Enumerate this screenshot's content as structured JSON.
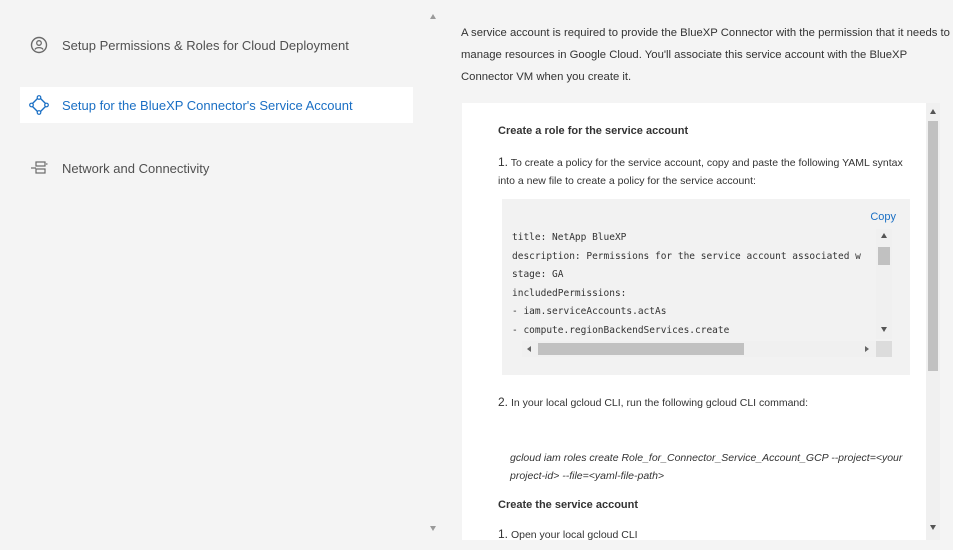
{
  "sidebar": {
    "items": [
      {
        "label": "Setup Permissions & Roles for Cloud Deployment",
        "icon": "user-circle-icon",
        "active": false
      },
      {
        "label": "Setup for the BlueXP Connector's Service Account",
        "icon": "connector-diamond-icon",
        "active": true
      },
      {
        "label": "Network and Connectivity",
        "icon": "network-icon",
        "active": false
      }
    ]
  },
  "main": {
    "intro": "A service account is required to provide the BlueXP Connector with the permission that it needs to manage resources in Google Cloud. You'll associate this service account with the BlueXP Connector VM when you create it.",
    "section1_title": "Create a role for the service account",
    "step1_num": "1.",
    "step1_text": "To create a policy for the service account, copy and paste the following YAML syntax into a new file to create a policy for the service account:",
    "copy_label": "Copy",
    "code_lines": [
      "title: NetApp BlueXP",
      "description: Permissions for the service account associated w",
      "stage: GA",
      "includedPermissions:",
      "- iam.serviceAccounts.actAs",
      "- compute.regionBackendServices.create"
    ],
    "step2_num": "2.",
    "step2_text": "In your local gcloud CLI, run the following gcloud CLI command:",
    "command": "gcloud iam roles create Role_for_Connector_Service_Account_GCP --project=<your project-id> --file=<yaml-file-path>",
    "section2_title": "Create the service account",
    "step3_num": "1.",
    "step3_text": "Open your local gcloud CLI"
  },
  "colors": {
    "accent": "#1a6fc4",
    "background": "#f4f4f4",
    "card": "#ffffff",
    "code_bg": "#f2f2f2"
  }
}
